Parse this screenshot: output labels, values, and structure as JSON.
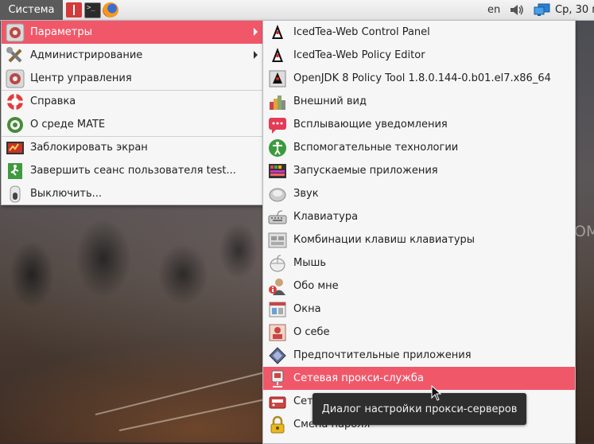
{
  "panel": {
    "system_menu": "Система",
    "lang": "en",
    "clock": "Ср, 30 м"
  },
  "left_menu": {
    "items": [
      {
        "label": "Параметры",
        "icon": "preferences-gear-icon",
        "submenu": true,
        "selected": true
      },
      {
        "label": "Администрирование",
        "icon": "admin-tools-icon",
        "submenu": true
      },
      {
        "label": "Центр управления",
        "icon": "control-center-icon"
      },
      {
        "label": "Справка",
        "icon": "help-lifebuoy-icon"
      },
      {
        "label": "О среде MATE",
        "icon": "mate-logo-icon"
      },
      {
        "label": "Заблокировать экран",
        "icon": "lock-screen-icon"
      },
      {
        "label": "Завершить сеанс пользователя test...",
        "icon": "logout-icon"
      },
      {
        "label": "Выключить...",
        "icon": "shutdown-switch-icon"
      }
    ]
  },
  "right_menu": {
    "items": [
      {
        "label": "IcedTea-Web Control Panel",
        "icon": "java-duke-icon"
      },
      {
        "label": "IcedTea-Web Policy Editor",
        "icon": "java-duke-icon"
      },
      {
        "label": "OpenJDK 8 Policy Tool 1.8.0.144-0.b01.el7.x86_64",
        "icon": "java-policy-icon"
      },
      {
        "label": "Внешний вид",
        "icon": "appearance-icon"
      },
      {
        "label": "Всплывающие уведомления",
        "icon": "notification-bubble-icon"
      },
      {
        "label": "Вспомогательные технологии",
        "icon": "accessibility-icon"
      },
      {
        "label": "Запускаемые приложения",
        "icon": "startup-apps-icon"
      },
      {
        "label": "Звук",
        "icon": "sound-icon"
      },
      {
        "label": "Клавиатура",
        "icon": "keyboard-icon"
      },
      {
        "label": "Комбинации клавиш клавиатуры",
        "icon": "keyboard-shortcuts-icon"
      },
      {
        "label": "Мышь",
        "icon": "mouse-icon"
      },
      {
        "label": "Обо мне",
        "icon": "about-me-icon"
      },
      {
        "label": "Окна",
        "icon": "windows-icon"
      },
      {
        "label": "О себе",
        "icon": "personal-info-icon"
      },
      {
        "label": "Предпочтительные приложения",
        "icon": "preferred-apps-icon"
      },
      {
        "label": "Сетевая прокси-служба",
        "icon": "network-proxy-icon",
        "selected": true
      },
      {
        "label": "Сетевые соединения",
        "icon": "network-connections-icon"
      },
      {
        "label": "Смена пароля",
        "icon": "password-lock-icon"
      }
    ]
  },
  "tooltip": "Диалог настройки прокси-серверов",
  "colors": {
    "selection": "#f0586a",
    "menu_bg": "#f6f6f6",
    "panel_system_bg": "#5b5b5b",
    "tooltip_bg": "#2e2e2e"
  }
}
